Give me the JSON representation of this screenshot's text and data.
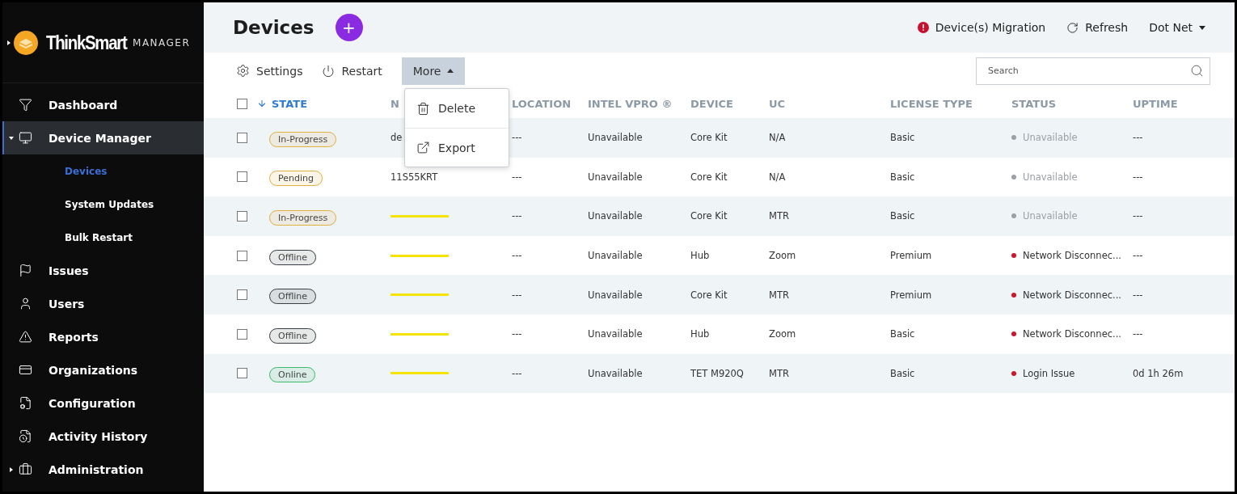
{
  "sidebar": {
    "logo": {
      "brand": "ThinkSmart",
      "product": "MANAGER"
    },
    "items": [
      {
        "label": "Dashboard",
        "selected": false
      },
      {
        "label": "Device Manager",
        "selected": true,
        "expanded": true,
        "children": [
          {
            "label": "Devices",
            "selected": true
          },
          {
            "label": "System Updates",
            "selected": false
          },
          {
            "label": "Bulk Restart",
            "selected": false
          }
        ]
      },
      {
        "label": "Issues",
        "selected": false
      },
      {
        "label": "Users",
        "selected": false
      },
      {
        "label": "Reports",
        "selected": false
      },
      {
        "label": "Organizations",
        "selected": false
      },
      {
        "label": "Configuration",
        "selected": false
      },
      {
        "label": "Activity History",
        "selected": false
      },
      {
        "label": "Administration",
        "selected": false,
        "expanded": false
      }
    ]
  },
  "header": {
    "title": "Devices",
    "add_button": "+",
    "migration": "Device(s) Migration",
    "refresh": "Refresh",
    "account": "Dot Net"
  },
  "toolbar": {
    "settings": "Settings",
    "restart": "Restart",
    "more": "More",
    "more_open": true,
    "search": {
      "placeholder": "Search"
    }
  },
  "more_menu": [
    "Delete",
    "Export"
  ],
  "table": {
    "select_all_checked": false,
    "columns": [
      {
        "label": "STATE",
        "sorted": true
      },
      {
        "label": "N",
        "sorted": false
      },
      {
        "label": "LOCATION",
        "sorted": false
      },
      {
        "label": "INTEL VPRO ®",
        "sorted": false
      },
      {
        "label": "DEVICE",
        "sorted": false
      },
      {
        "label": "UC",
        "sorted": false
      },
      {
        "label": "LICENSE TYPE",
        "sorted": false
      },
      {
        "label": "STATUS",
        "sorted": false
      },
      {
        "label": "UPTIME",
        "sorted": false
      }
    ],
    "rows": [
      {
        "checked": false,
        "state": {
          "label": "In-Progress",
          "color": "#e0b040"
        },
        "name": "de",
        "redacted": false,
        "location": "---",
        "vpro": "Unavailable",
        "device": "Core Kit",
        "uc": "N/A",
        "license": "Basic",
        "status": {
          "label": "Unavailable",
          "color": "#9aa0a6",
          "muted": true
        },
        "uptime": "---"
      },
      {
        "checked": false,
        "state": {
          "label": "Pending",
          "color": "#e0b040"
        },
        "name": "11S55KRT",
        "redacted": false,
        "location": "---",
        "vpro": "Unavailable",
        "device": "Core Kit",
        "uc": "N/A",
        "license": "Basic",
        "status": {
          "label": "Unavailable",
          "color": "#9aa0a6",
          "muted": true
        },
        "uptime": "---"
      },
      {
        "checked": false,
        "state": {
          "label": "In-Progress",
          "color": "#e0b040"
        },
        "redacted": true,
        "location": "---",
        "vpro": "Unavailable",
        "device": "Core Kit",
        "uc": "MTR",
        "license": "Basic",
        "status": {
          "label": "Unavailable",
          "color": "#9aa0a6",
          "muted": true
        },
        "uptime": "---"
      },
      {
        "checked": false,
        "state": {
          "label": "Offline",
          "color": "#3a3f45"
        },
        "redacted": true,
        "location": "---",
        "vpro": "Unavailable",
        "device": "Hub",
        "uc": "Zoom",
        "license": "Premium",
        "status": {
          "label": "Network Disconnec...",
          "color": "#d0142c",
          "muted": false
        },
        "uptime": "---"
      },
      {
        "checked": false,
        "state": {
          "label": "Offline",
          "color": "#3a3f45"
        },
        "redacted": true,
        "location": "---",
        "vpro": "Unavailable",
        "device": "Core Kit",
        "uc": "MTR",
        "license": "Premium",
        "status": {
          "label": "Network Disconnec...",
          "color": "#d0142c",
          "muted": false
        },
        "uptime": "---"
      },
      {
        "checked": false,
        "state": {
          "label": "Offline",
          "color": "#3a3f45"
        },
        "redacted": true,
        "location": "---",
        "vpro": "Unavailable",
        "device": "Hub",
        "uc": "Zoom",
        "license": "Basic",
        "status": {
          "label": "Network Disconnec...",
          "color": "#d0142c",
          "muted": false
        },
        "uptime": "---"
      },
      {
        "checked": false,
        "state": {
          "label": "Online",
          "color": "#3dba6a"
        },
        "redacted": true,
        "location": "---",
        "vpro": "Unavailable",
        "device": "TET M920Q",
        "uc": "MTR",
        "license": "Basic",
        "status": {
          "label": "Login Issue",
          "color": "#d0142c",
          "muted": false
        },
        "uptime": "0d 1h 26m"
      }
    ]
  }
}
